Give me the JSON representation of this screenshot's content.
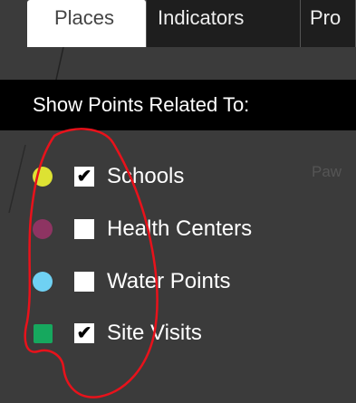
{
  "tabs": [
    {
      "label": "Places",
      "active": true
    },
    {
      "label": "Indicators",
      "active": false
    },
    {
      "label": "Pro",
      "active": false
    }
  ],
  "panel": {
    "header": "Show Points Related To:",
    "layers": [
      {
        "label": "Schools",
        "checked": true,
        "check_glyph": "✔",
        "color": "#dde233",
        "shape": "circle"
      },
      {
        "label": "Health Centers",
        "checked": false,
        "check_glyph": "",
        "color": "#8e3462",
        "shape": "circle"
      },
      {
        "label": "Water Points",
        "checked": false,
        "check_glyph": "",
        "color": "#6fd1f3",
        "shape": "circle"
      },
      {
        "label": "Site Visits",
        "checked": true,
        "check_glyph": "✔",
        "color": "#16a85e",
        "shape": "square"
      }
    ]
  },
  "map": {
    "place_label": "Paw"
  },
  "colors": {
    "annotation": "#e8121b",
    "panel_header_bg": "#000000",
    "map_bg": "#3b3b3b"
  }
}
